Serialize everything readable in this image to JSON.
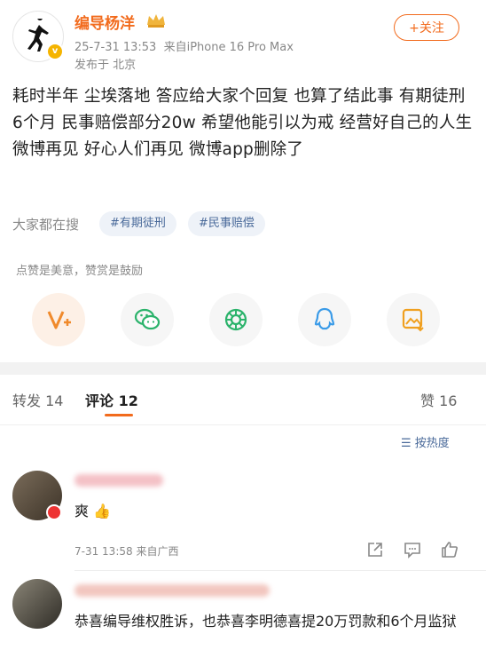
{
  "author": {
    "name": "编导杨洋",
    "timestamp": "25-7-31 13:53",
    "source": "来自iPhone 16 Pro Max",
    "location": "发布于 北京"
  },
  "follow_label": "+关注",
  "post_text": "耗时半年 尘埃落地 答应给大家个回复 也算了结此事 有期徒刑6个月 民事赔偿部分20w 希望他能引以为戒 经营好自己的人生 微博再见 好心人们再见 微博app删除了",
  "search": {
    "label": "大家都在搜",
    "tags": [
      "#有期徒刑",
      "#民事赔偿"
    ]
  },
  "reward_hint": "点赞是美意，赞赏是鼓励",
  "share_icons": [
    "reward-v-icon",
    "wechat-icon",
    "moments-icon",
    "qq-icon",
    "save-image-icon"
  ],
  "tabs": {
    "repost": "转发 14",
    "comment": "评论 12",
    "like": "赞 16"
  },
  "sort_label": "按热度",
  "comments": [
    {
      "text": "爽",
      "time": "7-31 13:58 来自广西"
    },
    {
      "text": "恭喜编导维权胜诉，也恭喜李明德喜提20万罚款和6个月监狱"
    }
  ],
  "colors": {
    "accent": "#f26b1d",
    "tag_text": "#4a6a9a"
  }
}
